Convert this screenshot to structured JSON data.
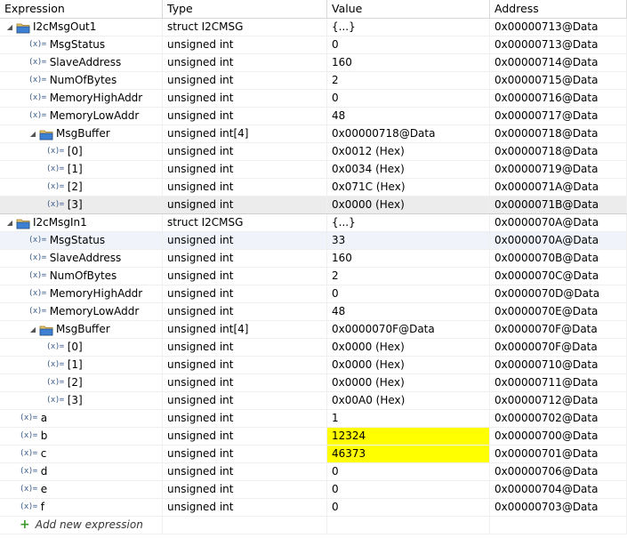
{
  "headers": {
    "expression": "Expression",
    "type": "Type",
    "value": "Value",
    "address": "Address"
  },
  "rows": [
    {
      "expr": "I2cMsgOut1",
      "type": "struct I2CMSG",
      "value": "{...}",
      "addr": "0x00000713@Data",
      "level": 0,
      "kind": "struct",
      "tw": "◢"
    },
    {
      "expr": "MsgStatus",
      "type": "unsigned int",
      "value": "0",
      "addr": "0x00000713@Data",
      "level": 1,
      "kind": "var"
    },
    {
      "expr": "SlaveAddress",
      "type": "unsigned int",
      "value": "160",
      "addr": "0x00000714@Data",
      "level": 1,
      "kind": "var"
    },
    {
      "expr": "NumOfBytes",
      "type": "unsigned int",
      "value": "2",
      "addr": "0x00000715@Data",
      "level": 1,
      "kind": "var"
    },
    {
      "expr": "MemoryHighAddr",
      "type": "unsigned int",
      "value": "0",
      "addr": "0x00000716@Data",
      "level": 1,
      "kind": "var"
    },
    {
      "expr": "MemoryLowAddr",
      "type": "unsigned int",
      "value": "48",
      "addr": "0x00000717@Data",
      "level": 1,
      "kind": "var"
    },
    {
      "expr": "MsgBuffer",
      "type": "unsigned int[4]",
      "value": "0x00000718@Data",
      "addr": "0x00000718@Data",
      "level": 1,
      "kind": "struct",
      "tw": "◢"
    },
    {
      "expr": "[0]",
      "type": "unsigned int",
      "value": "0x0012 (Hex)",
      "addr": "0x00000718@Data",
      "level": 2,
      "kind": "var"
    },
    {
      "expr": "[1]",
      "type": "unsigned int",
      "value": "0x0034 (Hex)",
      "addr": "0x00000719@Data",
      "level": 2,
      "kind": "var"
    },
    {
      "expr": "[2]",
      "type": "unsigned int",
      "value": "0x071C (Hex)",
      "addr": "0x0000071A@Data",
      "level": 2,
      "kind": "var"
    },
    {
      "expr": "[3]",
      "type": "unsigned int",
      "value": "0x0000 (Hex)",
      "addr": "0x0000071B@Data",
      "level": 2,
      "kind": "var",
      "state": "sel"
    },
    {
      "expr": "I2cMsgIn1",
      "type": "struct I2CMSG",
      "value": "{...}",
      "addr": "0x0000070A@Data",
      "level": 0,
      "kind": "struct",
      "tw": "◢"
    },
    {
      "expr": "MsgStatus",
      "type": "unsigned int",
      "value": "33",
      "addr": "0x0000070A@Data",
      "level": 1,
      "kind": "var",
      "state": "hover"
    },
    {
      "expr": "SlaveAddress",
      "type": "unsigned int",
      "value": "160",
      "addr": "0x0000070B@Data",
      "level": 1,
      "kind": "var"
    },
    {
      "expr": "NumOfBytes",
      "type": "unsigned int",
      "value": "2",
      "addr": "0x0000070C@Data",
      "level": 1,
      "kind": "var"
    },
    {
      "expr": "MemoryHighAddr",
      "type": "unsigned int",
      "value": "0",
      "addr": "0x0000070D@Data",
      "level": 1,
      "kind": "var"
    },
    {
      "expr": "MemoryLowAddr",
      "type": "unsigned int",
      "value": "48",
      "addr": "0x0000070E@Data",
      "level": 1,
      "kind": "var"
    },
    {
      "expr": "MsgBuffer",
      "type": "unsigned int[4]",
      "value": "0x0000070F@Data",
      "addr": "0x0000070F@Data",
      "level": 1,
      "kind": "struct",
      "tw": "◢"
    },
    {
      "expr": "[0]",
      "type": "unsigned int",
      "value": "0x0000 (Hex)",
      "addr": "0x0000070F@Data",
      "level": 2,
      "kind": "var"
    },
    {
      "expr": "[1]",
      "type": "unsigned int",
      "value": "0x0000 (Hex)",
      "addr": "0x00000710@Data",
      "level": 2,
      "kind": "var"
    },
    {
      "expr": "[2]",
      "type": "unsigned int",
      "value": "0x0000 (Hex)",
      "addr": "0x00000711@Data",
      "level": 2,
      "kind": "var"
    },
    {
      "expr": "[3]",
      "type": "unsigned int",
      "value": "0x00A0 (Hex)",
      "addr": "0x00000712@Data",
      "level": 2,
      "kind": "var"
    },
    {
      "expr": "a",
      "type": "unsigned int",
      "value": "1",
      "addr": "0x00000702@Data",
      "level": 0,
      "kind": "var"
    },
    {
      "expr": "b",
      "type": "unsigned int",
      "value": "12324",
      "addr": "0x00000700@Data",
      "level": 0,
      "kind": "var",
      "changed": true
    },
    {
      "expr": "c",
      "type": "unsigned int",
      "value": "46373",
      "addr": "0x00000701@Data",
      "level": 0,
      "kind": "var",
      "changed": true
    },
    {
      "expr": "d",
      "type": "unsigned int",
      "value": "0",
      "addr": "0x00000706@Data",
      "level": 0,
      "kind": "var"
    },
    {
      "expr": "e",
      "type": "unsigned int",
      "value": "0",
      "addr": "0x00000704@Data",
      "level": 0,
      "kind": "var"
    },
    {
      "expr": "f",
      "type": "unsigned int",
      "value": "0",
      "addr": "0x00000703@Data",
      "level": 0,
      "kind": "var"
    }
  ],
  "var_icon_text": "(x)=",
  "add_expression": {
    "plus": "+",
    "label": "Add new expression"
  },
  "colors": {
    "changed_value": "#ffff00",
    "selected_row": "#ececec"
  }
}
